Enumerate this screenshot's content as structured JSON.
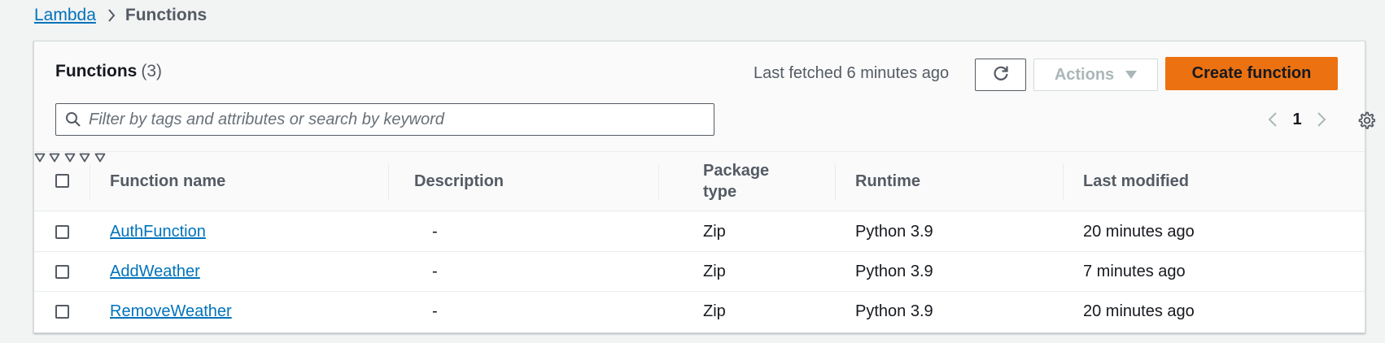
{
  "breadcrumb": {
    "root": "Lambda",
    "current": "Functions"
  },
  "panel": {
    "title": "Functions",
    "count": "(3)",
    "last_fetched": "Last fetched 6 minutes ago",
    "actions_label": "Actions",
    "create_label": "Create function"
  },
  "search": {
    "placeholder": "Filter by tags and attributes or search by keyword",
    "value": ""
  },
  "pagination": {
    "current_page": "1"
  },
  "table": {
    "columns": [
      "Function name",
      "Description",
      "Package type",
      "Runtime",
      "Last modified"
    ],
    "rows": [
      {
        "name": "AuthFunction",
        "description": "-",
        "package_type": "Zip",
        "runtime": "Python 3.9",
        "last_modified": "20 minutes ago"
      },
      {
        "name": "AddWeather",
        "description": "-",
        "package_type": "Zip",
        "runtime": "Python 3.9",
        "last_modified": "7 minutes ago"
      },
      {
        "name": "RemoveWeather",
        "description": "-",
        "package_type": "Zip",
        "runtime": "Python 3.9",
        "last_modified": "20 minutes ago"
      }
    ]
  },
  "colors": {
    "link": "#0073bb",
    "primary_button": "#ec7211",
    "border": "#d5dbdb",
    "muted_text": "#545b64"
  },
  "icons": {
    "breadcrumb_separator": "chevron-right-icon",
    "refresh": "refresh-icon",
    "actions_caret": "caret-down-icon",
    "search": "search-icon",
    "prev_page": "chevron-left-icon",
    "next_page": "chevron-right-icon",
    "settings": "gear-icon",
    "sort": "sort-caret-icon"
  }
}
